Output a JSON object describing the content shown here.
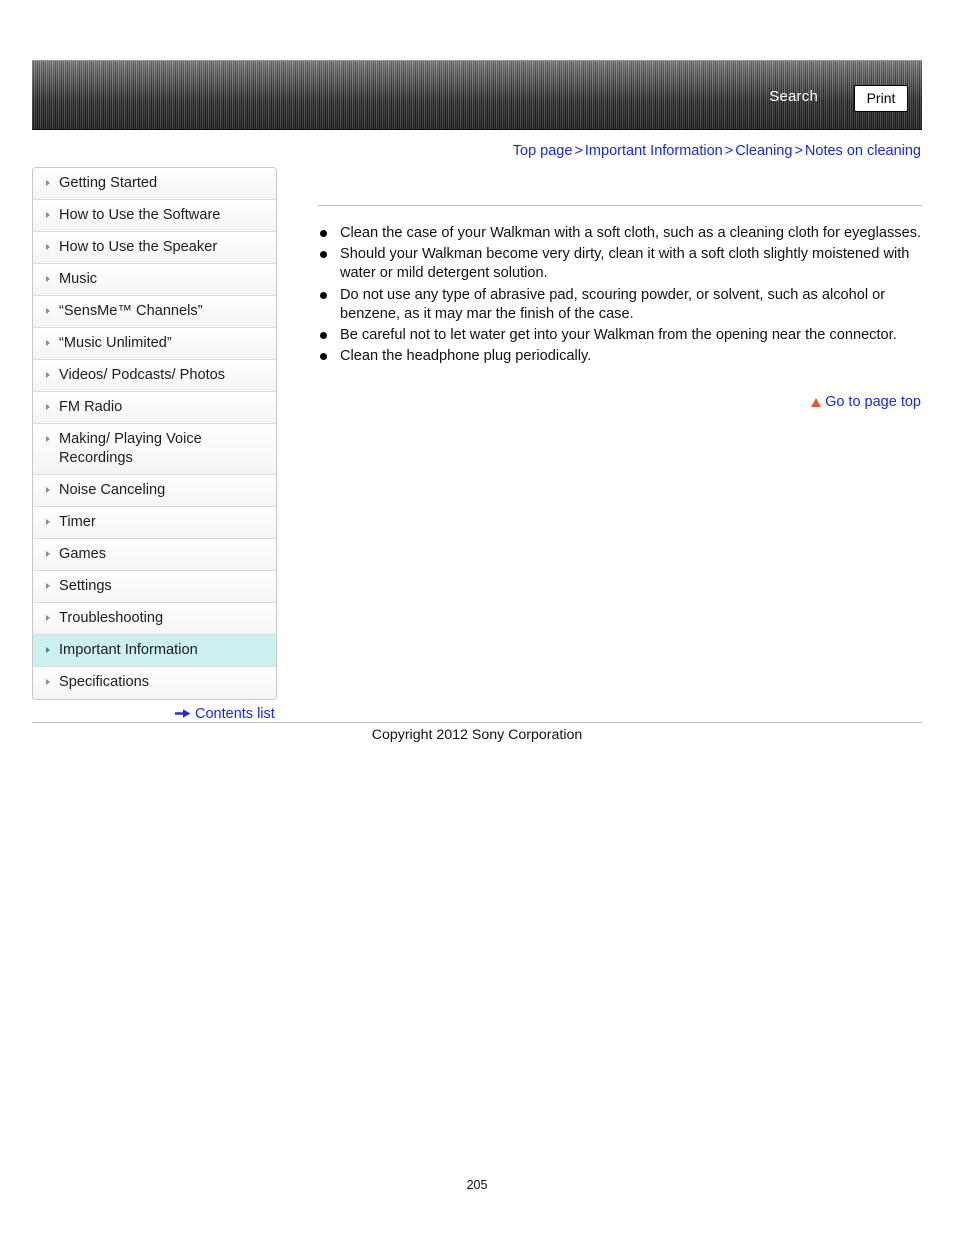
{
  "header": {
    "search_label": "Search",
    "print_label": "Print"
  },
  "breadcrumb": {
    "items": [
      "Top page",
      "Important Information",
      "Cleaning",
      "Notes on cleaning"
    ],
    "separator": ">"
  },
  "sidebar": {
    "items": [
      {
        "label": "Getting Started",
        "selected": false
      },
      {
        "label": "How to Use the Software",
        "selected": false
      },
      {
        "label": "How to Use the Speaker",
        "selected": false
      },
      {
        "label": "Music",
        "selected": false
      },
      {
        "label": "“SensMe™ Channels”",
        "selected": false
      },
      {
        "label": "“Music Unlimited”",
        "selected": false
      },
      {
        "label": "Videos/ Podcasts/ Photos",
        "selected": false
      },
      {
        "label": "FM Radio",
        "selected": false
      },
      {
        "label": "Making/ Playing Voice Recordings",
        "selected": false,
        "two_line": true
      },
      {
        "label": "Noise Canceling",
        "selected": false
      },
      {
        "label": "Timer",
        "selected": false
      },
      {
        "label": "Games",
        "selected": false
      },
      {
        "label": "Settings",
        "selected": false
      },
      {
        "label": "Troubleshooting",
        "selected": false
      },
      {
        "label": "Important Information",
        "selected": true
      },
      {
        "label": "Specifications",
        "selected": false
      }
    ],
    "contents_list_label": "Contents list"
  },
  "main": {
    "bullets": [
      "Clean the case of your Walkman with a soft cloth, such as a cleaning cloth for eyeglasses.",
      "Should your Walkman become very dirty, clean it with a soft cloth slightly moistened with water or mild detergent solution.",
      "Do not use any type of abrasive pad, scouring powder, or solvent, such as alcohol or benzene, as it may mar the finish of the case.",
      "Be careful not to let water get into your Walkman from the opening near the connector.",
      "Clean the headphone plug periodically."
    ],
    "go_to_page_top": "Go to page top"
  },
  "footer": {
    "copyright": "Copyright 2012 Sony Corporation",
    "page_number": "205"
  },
  "colors": {
    "link": "#1a2ad0",
    "selected_nav": "#ccefef",
    "go_top_arrow": "#e05a2b"
  }
}
